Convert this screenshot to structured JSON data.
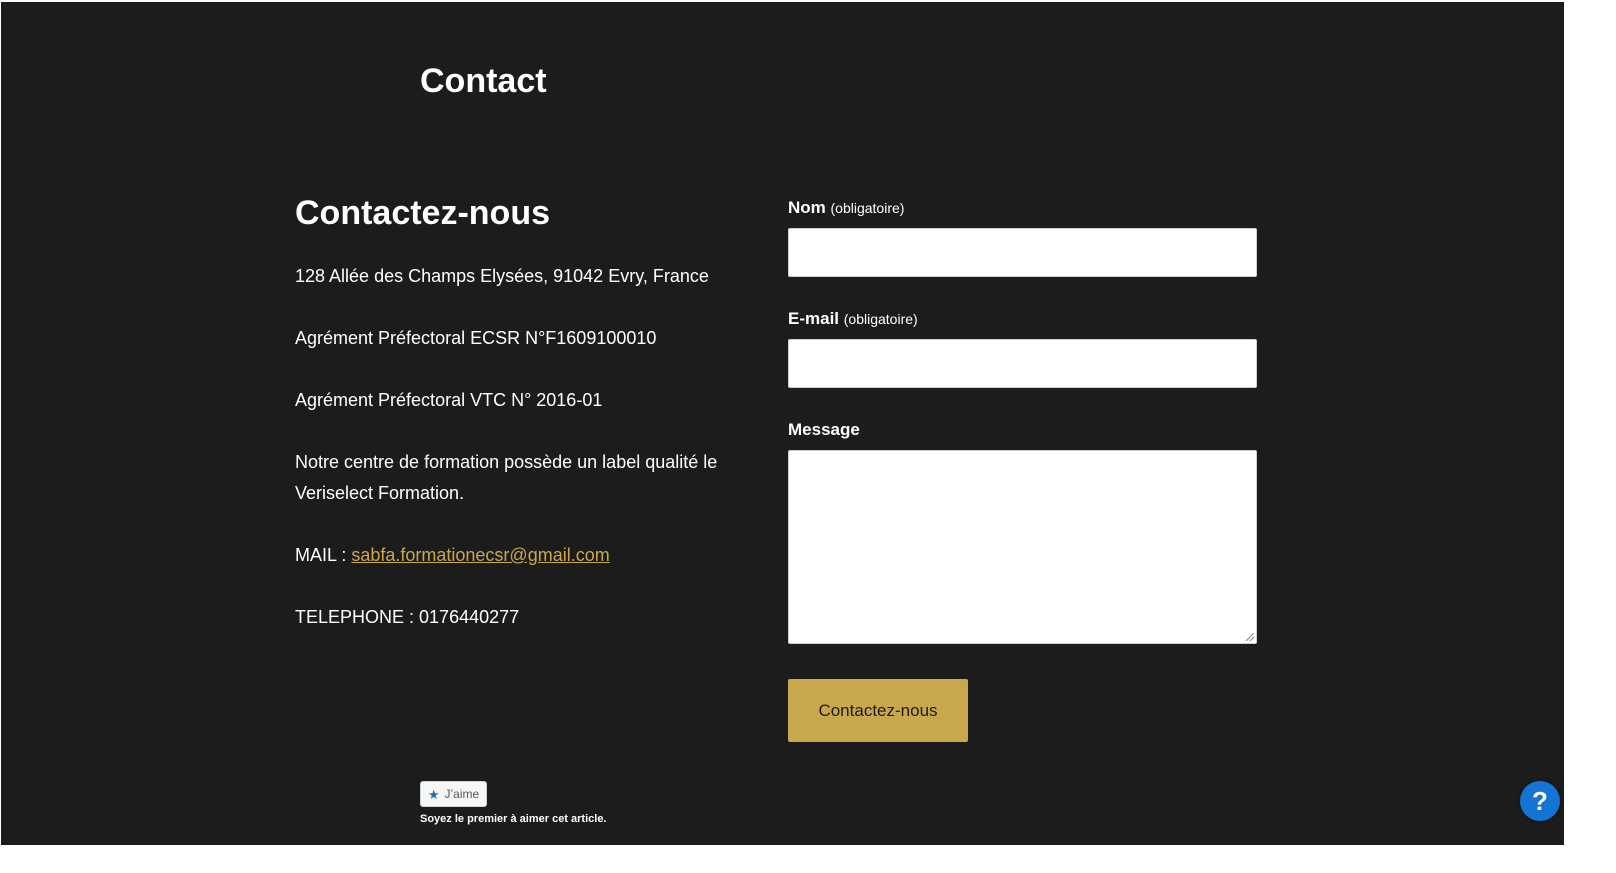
{
  "page": {
    "title": "Contact"
  },
  "contact_info": {
    "heading": "Contactez-nous",
    "address": "128 Allée des Champs Elysées, 91042 Evry, France",
    "ecsr_agreement": "Agrément Préfectoral ECSR N°F1609100010",
    "vtc_agreement": "Agrément Préfectoral VTC N° 2016-01",
    "quality_label": "Notre centre de formation possède un label qualité le Veriselect Formation.",
    "mail_prefix": "MAIL : ",
    "mail_address": "sabfa.formationecsr@gmail.com",
    "phone": "TELEPHONE : 0176440277"
  },
  "form": {
    "name_label": "Nom",
    "name_required": "(obligatoire)",
    "name_value": "",
    "email_label": "E-mail",
    "email_required": "(obligatoire)",
    "email_value": "",
    "message_label": "Message",
    "message_value": "",
    "submit_label": "Contactez-nous"
  },
  "likes": {
    "button_label": "J’aime",
    "button_icon": "star-icon",
    "caption": "Soyez le premier à aimer cet article."
  },
  "help": {
    "label": "?",
    "icon": "help-icon"
  },
  "colors": {
    "background": "#1c1c1c",
    "accent": "#c9a84c",
    "help_button": "#1474d4"
  }
}
